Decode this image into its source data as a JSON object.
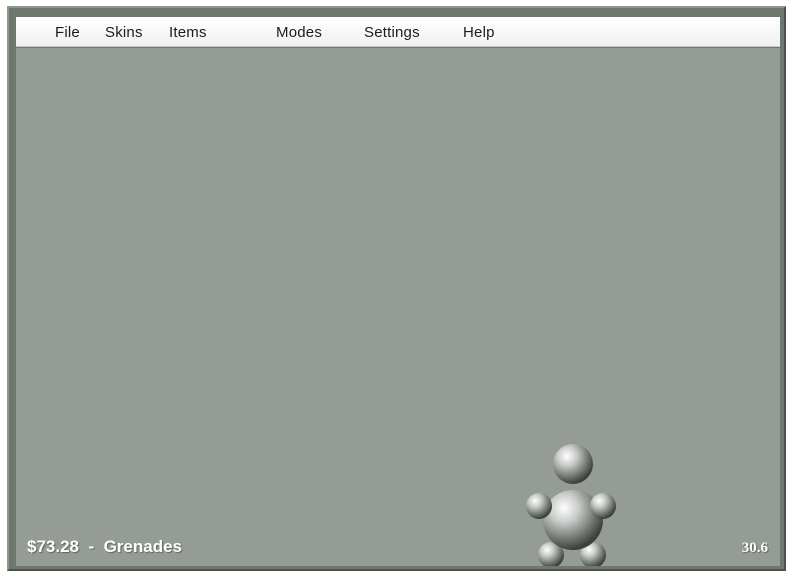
{
  "menu": {
    "items": [
      {
        "label": "File"
      },
      {
        "label": "Skins"
      },
      {
        "label": "Items"
      },
      {
        "label": "Modes"
      },
      {
        "label": "Settings"
      },
      {
        "label": "Help"
      }
    ]
  },
  "hud": {
    "money": "$73.28",
    "separator": "-",
    "weapon": "Grenades",
    "fps": "30.6"
  },
  "colors": {
    "playfield": "#959b95",
    "frame": "#6f786f",
    "menubar": "#ffffff",
    "hud_text": "#ffffff"
  },
  "character": {
    "description_icon": "ball-figure-icon"
  }
}
